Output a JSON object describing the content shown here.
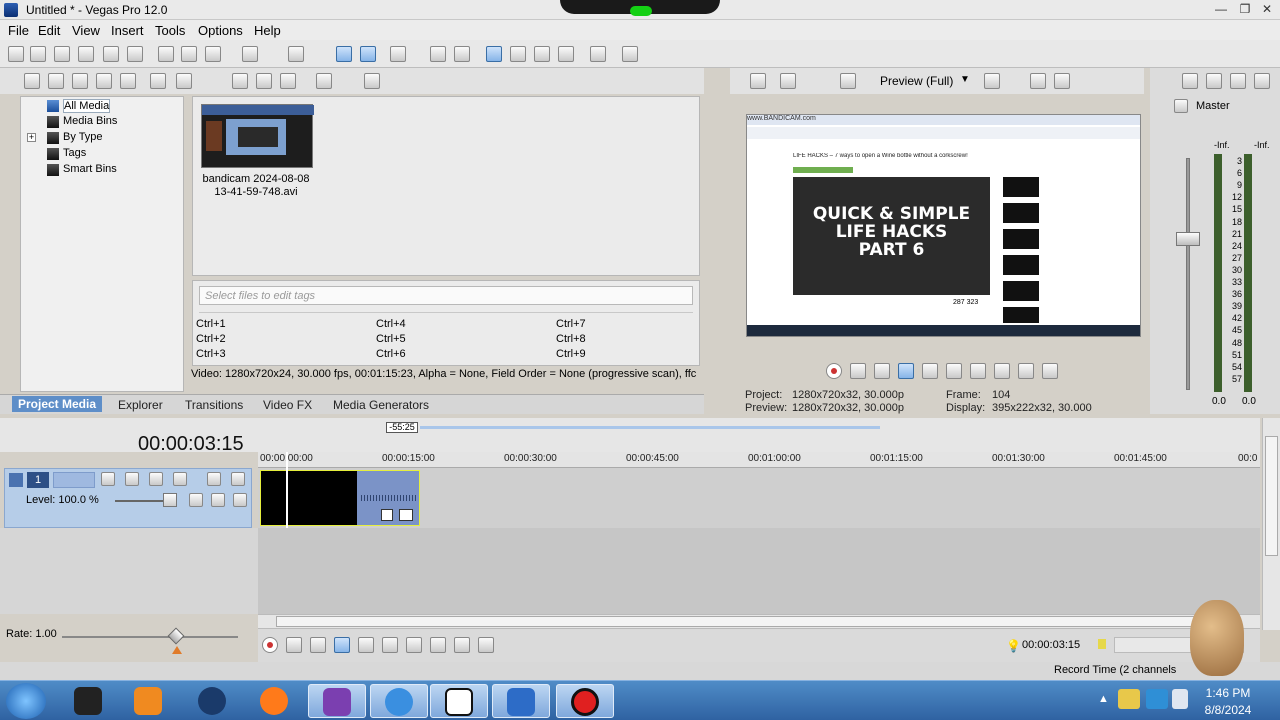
{
  "window": {
    "title": "Untitled * - Vegas Pro 12.0",
    "controls": {
      "minimize": "—",
      "maximize": "❐",
      "close": "✕"
    }
  },
  "menu": [
    "File",
    "Edit",
    "View",
    "Insert",
    "Tools",
    "Options",
    "Help"
  ],
  "project_media": {
    "tree": [
      {
        "label": "All Media",
        "selected": true
      },
      {
        "label": "Media Bins"
      },
      {
        "label": "By Type",
        "expand": "+"
      },
      {
        "label": "Tags"
      },
      {
        "label": "Smart Bins"
      }
    ],
    "media_files": [
      {
        "name_line1": "bandicam 2024-08-08",
        "name_line2": "13-41-59-748.avi"
      }
    ],
    "tags_placeholder": "Select files to edit tags",
    "shortcuts": [
      "Ctrl+1",
      "Ctrl+4",
      "Ctrl+7",
      "Ctrl+2",
      "Ctrl+5",
      "Ctrl+8",
      "Ctrl+3",
      "Ctrl+6",
      "Ctrl+9"
    ],
    "video_info": "Video: 1280x720x24, 30.000 fps, 00:01:15:23, Alpha = None, Field Order = None (progressive scan), ffc"
  },
  "tabs": [
    {
      "label": "Project Media",
      "active": true
    },
    {
      "label": "Explorer"
    },
    {
      "label": "Transitions"
    },
    {
      "label": "Video FX"
    },
    {
      "label": "Media Generators"
    }
  ],
  "preview": {
    "quality": "Preview (Full)",
    "video_frame": {
      "url_banner": "www.BANDICAM.com",
      "headline": "LIFE HACKS – 7 ways to open a Wine bottle without a corkscrew!",
      "overlay_line1": "QUICK & SIMPLE",
      "overlay_line2": "LIFE HACKS",
      "overlay_line3": "PART 6",
      "views": "287 323"
    },
    "project_label": "Project:",
    "project_value": "1280x720x32, 30.000p",
    "preview_label": "Preview:",
    "preview_value": "1280x720x32, 30.000p",
    "frame_label": "Frame:",
    "frame_value": "104",
    "display_label": "Display:",
    "display_value": "395x222x32, 30.000"
  },
  "mixer": {
    "master_label": "Master",
    "inf_left": "-Inf.",
    "inf_right": "-Inf.",
    "scale": [
      "3",
      "6",
      "9",
      "12",
      "15",
      "18",
      "21",
      "24",
      "27",
      "30",
      "33",
      "36",
      "39",
      "42",
      "45",
      "48",
      "51",
      "54",
      "57"
    ],
    "level_left": "0.0",
    "level_right": "0.0"
  },
  "timeline": {
    "timecode": "00:00:03:15",
    "loop_region": "-55:25",
    "ruler": [
      "00:00:00:00",
      "00:00:15:00",
      "00:00:30:00",
      "00:00:45:00",
      "00:01:00:00",
      "00:01:15:00",
      "00:01:30:00",
      "00:01:45:00",
      "00:0"
    ],
    "track_number": "1",
    "track_level": "Level: 100.0 %",
    "rate": "Rate: 1.00"
  },
  "transport": {
    "end_timecode": "00:00:03:15"
  },
  "status": {
    "record_time": "Record Time (2 channels"
  },
  "taskbar": {
    "time": "1:46 PM",
    "date": "8/8/2024",
    "apps": [
      "windows-start",
      "task-manager-app",
      "media-player-app",
      "globe-app",
      "firefox-app",
      "bandicam-app",
      "internet-explorer-app",
      "7zip-app",
      "vegas-pro-app",
      "record-app"
    ]
  },
  "colors": {
    "accent": "#5e8ec8",
    "track_header": "#b6cde8",
    "clip_video": "#000000",
    "clip_audio": "#7b93c7",
    "taskbar": "#3a72b4"
  }
}
